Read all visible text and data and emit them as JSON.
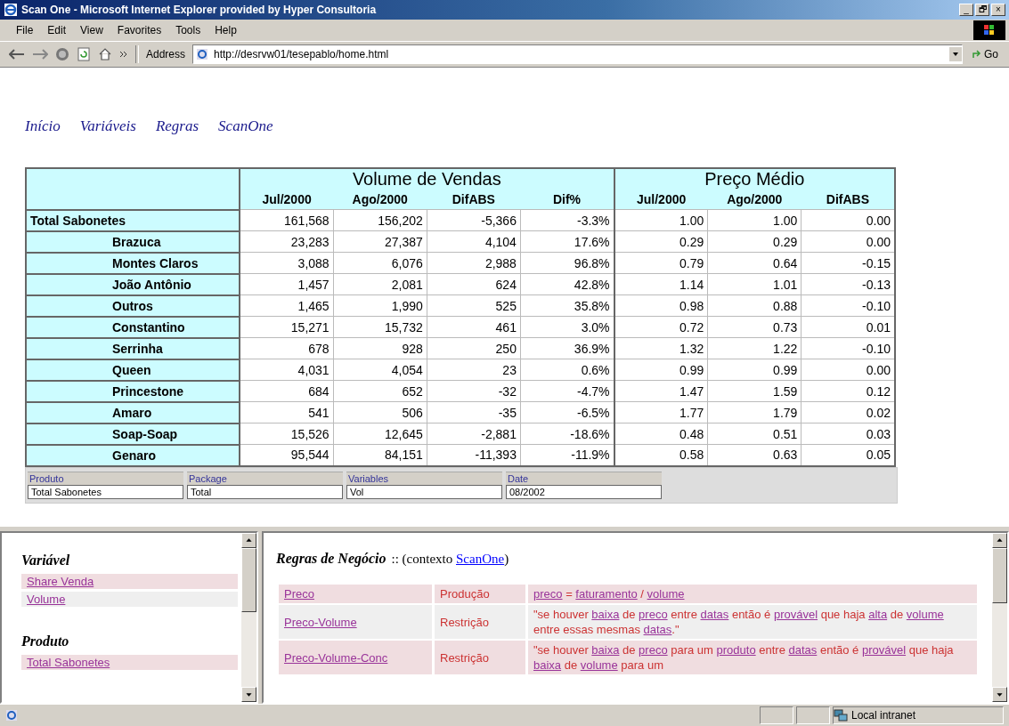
{
  "window": {
    "title": "Scan One - Microsoft Internet Explorer provided by Hyper Consultoria",
    "controls": [
      "_",
      "🗗",
      "×"
    ]
  },
  "menu": [
    "File",
    "Edit",
    "View",
    "Favorites",
    "Tools",
    "Help"
  ],
  "toolbar": {
    "address_label": "Address",
    "url": "http://desrvw01/tesepablo/home.html",
    "go": "Go"
  },
  "nav": [
    "Início",
    "Variáveis",
    "Regras",
    "ScanOne"
  ],
  "table": {
    "groups": [
      {
        "label": "Volume de Vendas",
        "columns": [
          "Jul/2000",
          "Ago/2000",
          "DifABS",
          "Dif%"
        ]
      },
      {
        "label": "Preço Médio",
        "columns": [
          "Jul/2000",
          "Ago/2000",
          "DifABS"
        ]
      }
    ],
    "rows": [
      {
        "label": "Total Sabonetes",
        "kind": "total",
        "cells": [
          "161,568",
          "156,202",
          "-5,366",
          "-3.3%",
          "1.00",
          "1.00",
          "0.00"
        ]
      },
      {
        "label": "Brazuca",
        "kind": "item",
        "cells": [
          "23,283",
          "27,387",
          "4,104",
          "17.6%",
          "0.29",
          "0.29",
          "0.00"
        ]
      },
      {
        "label": "Montes Claros",
        "kind": "item",
        "cells": [
          "3,088",
          "6,076",
          "2,988",
          "96.8%",
          "0.79",
          "0.64",
          "-0.15"
        ]
      },
      {
        "label": "João Antônio",
        "kind": "item",
        "cells": [
          "1,457",
          "2,081",
          "624",
          "42.8%",
          "1.14",
          "1.01",
          "-0.13"
        ]
      },
      {
        "label": "Outros",
        "kind": "item",
        "cells": [
          "1,465",
          "1,990",
          "525",
          "35.8%",
          "0.98",
          "0.88",
          "-0.10"
        ]
      },
      {
        "label": "Constantino",
        "kind": "item",
        "cells": [
          "15,271",
          "15,732",
          "461",
          "3.0%",
          "0.72",
          "0.73",
          "0.01"
        ]
      },
      {
        "label": "Serrinha",
        "kind": "item",
        "cells": [
          "678",
          "928",
          "250",
          "36.9%",
          "1.32",
          "1.22",
          "-0.10"
        ]
      },
      {
        "label": "Queen",
        "kind": "item",
        "cells": [
          "4,031",
          "4,054",
          "23",
          "0.6%",
          "0.99",
          "0.99",
          "0.00"
        ]
      },
      {
        "label": "Princestone",
        "kind": "item",
        "cells": [
          "684",
          "652",
          "-32",
          "-4.7%",
          "1.47",
          "1.59",
          "0.12"
        ]
      },
      {
        "label": "Amaro",
        "kind": "item",
        "cells": [
          "541",
          "506",
          "-35",
          "-6.5%",
          "1.77",
          "1.79",
          "0.02"
        ]
      },
      {
        "label": "Soap-Soap",
        "kind": "item",
        "cells": [
          "15,526",
          "12,645",
          "-2,881",
          "-18.6%",
          "0.48",
          "0.51",
          "0.03"
        ]
      },
      {
        "label": "Genaro",
        "kind": "item",
        "cells": [
          "95,544",
          "84,151",
          "-11,393",
          "-11.9%",
          "0.58",
          "0.63",
          "0.05"
        ]
      }
    ]
  },
  "filters": [
    {
      "label": "Produto",
      "value": "Total Sabonetes"
    },
    {
      "label": "Package",
      "value": "Total"
    },
    {
      "label": "Variables",
      "value": "Vol"
    },
    {
      "label": "Date",
      "value": "08/2002"
    }
  ],
  "left_frame": [
    {
      "heading": "Variável",
      "items": [
        "Share Venda",
        "Volume"
      ]
    },
    {
      "heading": "Produto",
      "items": [
        "Total Sabonetes"
      ]
    }
  ],
  "rules_panel": {
    "heading": "Regras de Negócio",
    "separator": "::",
    "context_prefix": "(contexto",
    "context_link": "ScanOne",
    "context_suffix": ")",
    "rules": [
      {
        "name": "Preco",
        "type": "Produção",
        "text": [
          {
            "t": "preco",
            "link": true
          },
          {
            "t": " = ",
            "link": false
          },
          {
            "t": "faturamento",
            "link": true
          },
          {
            "t": " / ",
            "link": false
          },
          {
            "t": "volume",
            "link": true
          }
        ]
      },
      {
        "name": "Preco-Volume",
        "type": "Restrição",
        "text": [
          {
            "t": "\"se houver ",
            "link": false
          },
          {
            "t": "baixa",
            "link": true
          },
          {
            "t": " de ",
            "link": false
          },
          {
            "t": "preco",
            "link": true
          },
          {
            "t": " entre ",
            "link": false
          },
          {
            "t": "datas",
            "link": true
          },
          {
            "t": " então é ",
            "link": false
          },
          {
            "t": "provável",
            "link": true
          },
          {
            "t": " que haja ",
            "link": false
          },
          {
            "t": "alta",
            "link": true
          },
          {
            "t": " de ",
            "link": false
          },
          {
            "t": "volume",
            "link": true
          },
          {
            "t": " entre essas mesmas ",
            "link": false
          },
          {
            "t": "datas",
            "link": true
          },
          {
            "t": ".\"",
            "link": false
          }
        ]
      },
      {
        "name": "Preco-Volume-Conc",
        "type": "Restrição",
        "text": [
          {
            "t": "\"se houver ",
            "link": false
          },
          {
            "t": "baixa",
            "link": true
          },
          {
            "t": " de ",
            "link": false
          },
          {
            "t": "preco",
            "link": true
          },
          {
            "t": " para um ",
            "link": false
          },
          {
            "t": "produto",
            "link": true
          },
          {
            "t": " entre ",
            "link": false
          },
          {
            "t": "datas",
            "link": true
          },
          {
            "t": " então é ",
            "link": false
          },
          {
            "t": "provável",
            "link": true
          },
          {
            "t": " que haja ",
            "link": false
          },
          {
            "t": "baixa",
            "link": true
          },
          {
            "t": " de ",
            "link": false
          },
          {
            "t": "volume",
            "link": true
          },
          {
            "t": " para um",
            "link": false
          }
        ]
      }
    ]
  },
  "status_bar": {
    "zone": "Local intranet"
  }
}
